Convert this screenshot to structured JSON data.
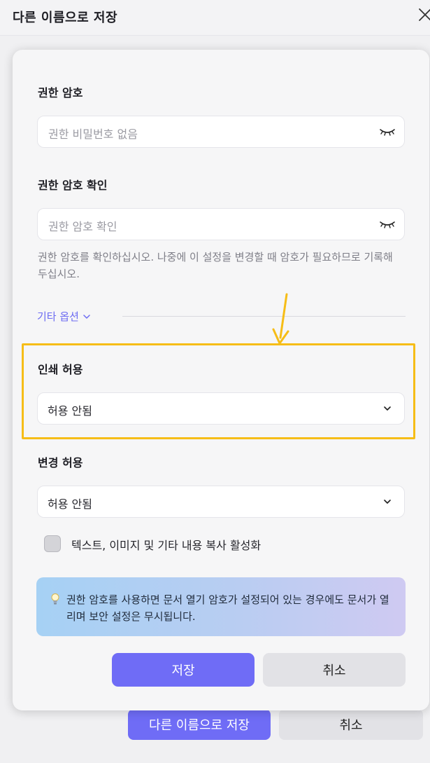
{
  "window": {
    "title": "다른 이름으로 저장",
    "footer_save_label": "다른 이름으로 저장",
    "footer_cancel_label": "취소"
  },
  "dialog": {
    "permission_password": {
      "label": "권한 암호",
      "placeholder": "권한 비밀번호 없음"
    },
    "confirm_password": {
      "label": "권한 암호 확인",
      "placeholder": "권한 암호 확인"
    },
    "helper_text": "권한 암호를 확인하십시오. 나중에 이 설정을 변경할 때 암호가 필요하므로 기록해 두십시오.",
    "more_options_label": "기타 옵션",
    "print_allow": {
      "label": "인쇄 허용",
      "value": "허용 안됨"
    },
    "change_allow": {
      "label": "변경 허용",
      "value": "허용 안됨"
    },
    "copy_checkbox": {
      "label": "텍스트, 이미지 및 기타 내용 복사 활성화",
      "checked": false
    },
    "info_text": "권한 암호를 사용하면 문서 열기 암호가 설정되어 있는 경우에도 문서가 열리며 보안 설정은 무시됩니다.",
    "save_label": "저장",
    "cancel_label": "취소"
  },
  "colors": {
    "accent": "#6f6cf6",
    "highlight": "#f6bd17"
  },
  "icons": {
    "window_close": "close-icon",
    "password_toggle": "eye-closed-icon",
    "dropdown": "chevron-down-icon",
    "info": "lightbulb-icon"
  }
}
